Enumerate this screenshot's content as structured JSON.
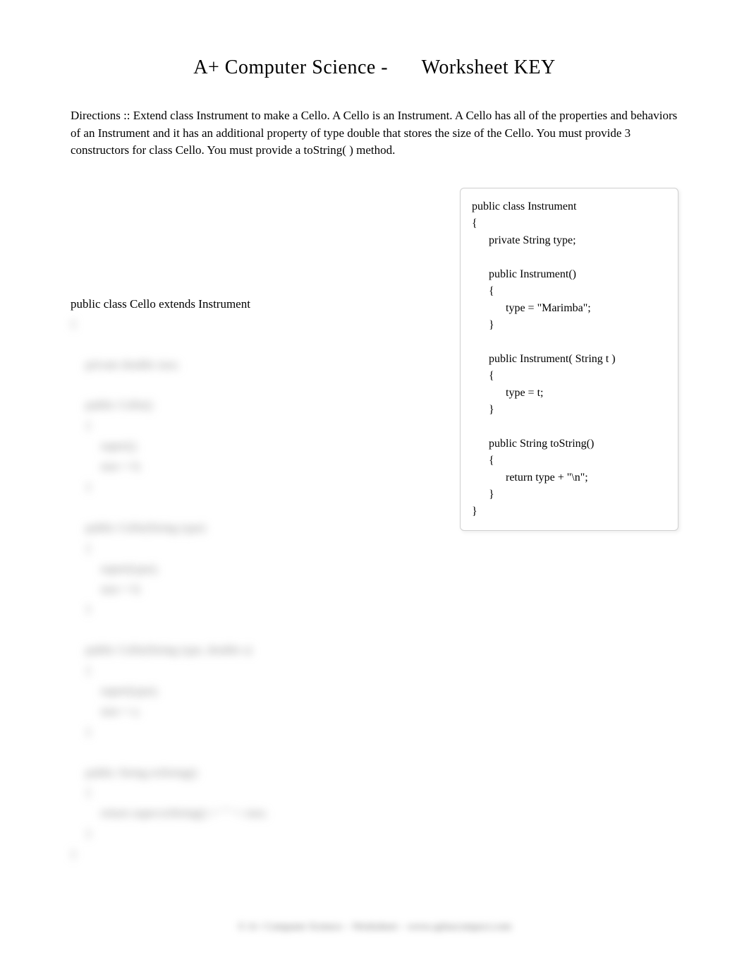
{
  "header": {
    "left": "A+ Computer Science -",
    "right": "Worksheet KEY"
  },
  "directions": "Directions ::  Extend class Instrument to make a Cello.   A Cello is an Instrument.   A Cello has all of the properties and behaviors of an Instrument and it has an additional property of type double that stores the size of the Cello.  You must provide 3 constructors for class Cello.   You must provide a toString( ) method.",
  "cello": {
    "declaration": "public class Cello extends Instrument",
    "body_blurred": "{\n\n     private double size;\n\n     public Cello()\n     {\n          super();\n          size = 0;\n     }\n\n     public Cello(String type)\n     {\n          super(type);\n          size = 0;\n     }\n\n     public Cello(String type, double s)\n     {\n          super(type);\n          size = s;\n     }\n\n     public String toString()\n     {\n          return super.toString() + \" \" + size;\n     }\n}"
  },
  "instrument": {
    "code": "public class Instrument\n{\n      private String type;\n\n      public Instrument()\n      {\n            type = \"Marimba\";\n      }\n\n      public Instrument( String t )\n      {\n            type = t;\n      }\n\n      public String toString()\n      {\n            return type + \"\\n\";\n      }\n}"
  },
  "footer": "© A+ Computer Science  –  Worksheet  –  www.apluscompsci.com"
}
